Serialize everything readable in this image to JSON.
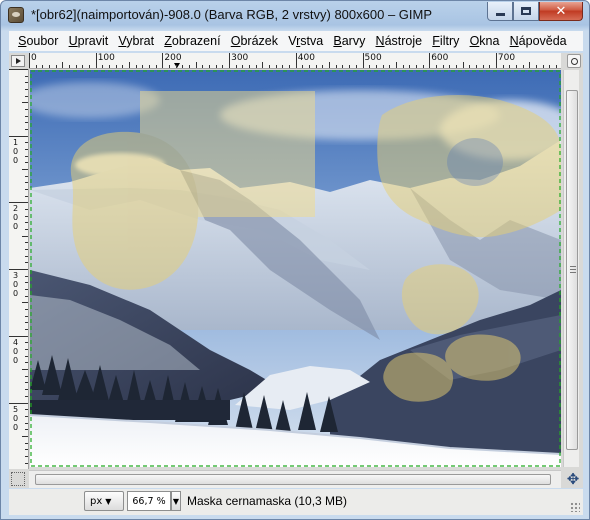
{
  "window": {
    "title": "*[obr62](naimportován)-908.0 (Barva RGB, 2 vrstvy) 800x600 – GIMP",
    "controls": {
      "minimize": "minimize-icon",
      "maximize": "maximize-icon",
      "close": "✕"
    }
  },
  "menu": [
    {
      "pre": "",
      "key": "S",
      "post": "oubor"
    },
    {
      "pre": "",
      "key": "U",
      "post": "pravit"
    },
    {
      "pre": "",
      "key": "V",
      "post": "ybrat"
    },
    {
      "pre": "",
      "key": "Z",
      "post": "obrazení"
    },
    {
      "pre": "",
      "key": "O",
      "post": "brázek"
    },
    {
      "pre": "V",
      "key": "r",
      "post": "stva"
    },
    {
      "pre": "",
      "key": "B",
      "post": "arvy"
    },
    {
      "pre": "",
      "key": "N",
      "post": "ástroje"
    },
    {
      "pre": "",
      "key": "F",
      "post": "iltry"
    },
    {
      "pre": "",
      "key": "O",
      "post": "kna"
    },
    {
      "pre": "",
      "key": "N",
      "post": "ápověda"
    }
  ],
  "ruler": {
    "h_labels": [
      "0",
      "100",
      "200",
      "300",
      "400",
      "500",
      "600",
      "700"
    ],
    "v_labels": [
      "1\n0\n0",
      "2\n0\n0",
      "3\n0\n0",
      "4\n0\n0",
      "5\n0\n0"
    ]
  },
  "canvas": {
    "content": "Snowy alpine valley photograph with semi-transparent yellow mask shapes",
    "selection_color": "#22aa22",
    "mask_color": "#e8cf72"
  },
  "status": {
    "unit": "px",
    "zoom": "66,7 %",
    "message": "Maska cernamaska (10,3 MB)"
  }
}
